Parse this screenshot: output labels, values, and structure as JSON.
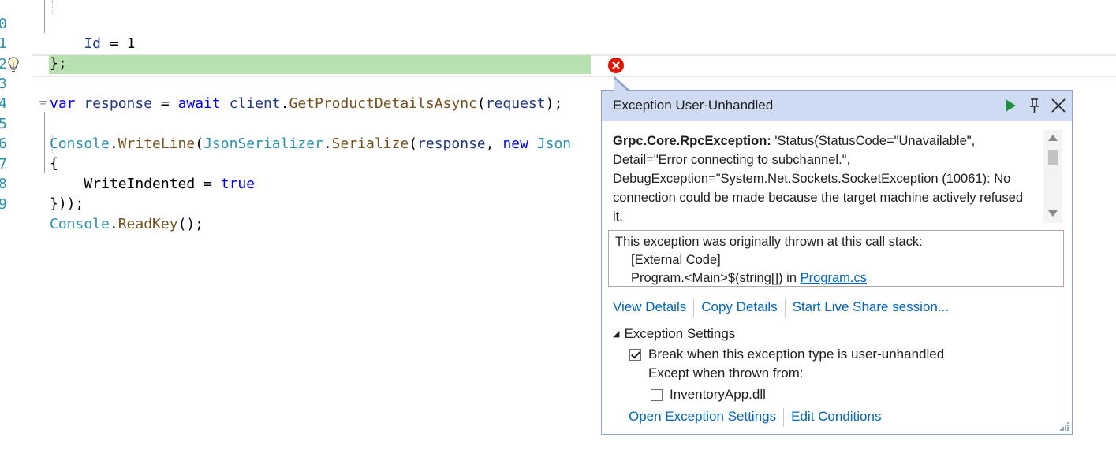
{
  "editor": {
    "lines": [
      {
        "num": "0",
        "code": "    Id = 1"
      },
      {
        "num": "1",
        "code": "};"
      },
      {
        "num": "2",
        "code": ""
      },
      {
        "num": "3",
        "code": "var response = await client.GetProductDetailsAsync(request);"
      },
      {
        "num": "4",
        "code": ""
      },
      {
        "num": "5",
        "code": "Console.WriteLine(JsonSerializer.Serialize(response, new Json"
      },
      {
        "num": "6",
        "code": "{"
      },
      {
        "num": "7",
        "code": "    WriteIndented = true"
      },
      {
        "num": "8",
        "code": "}));"
      },
      {
        "num": "9",
        "code": "Console.ReadKey();"
      }
    ],
    "highlight_color": "#b8e0b0",
    "error_icon": "error-circle-icon",
    "lightbulb_icon": "lightbulb-icon"
  },
  "popup": {
    "title": "Exception User-Unhandled",
    "continue_icon": "play-icon",
    "pin_icon": "pin-icon",
    "close_icon": "close-icon",
    "exception_type": "Grpc.Core.RpcException:",
    "exception_message": " 'Status(StatusCode=\"Unavailable\", Detail=\"Error connecting to subchannel.\", DebugException=\"System.Net.Sockets.SocketException (10061): No connection could be made because the target machine actively refused it.",
    "stack_intro": "This exception was originally thrown at this call stack:",
    "stack_external": "[External Code]",
    "stack_frame": "Program.<Main>$(string[]) in ",
    "stack_file": "Program.cs",
    "links": {
      "view_details": "View Details",
      "copy_details": "Copy Details",
      "live_share": "Start Live Share session..."
    },
    "settings": {
      "header": "Exception Settings",
      "break_label": "Break when this exception type is user-unhandled",
      "break_checked": true,
      "except_label": "Except when thrown from:",
      "module_label": "InventoryApp.dll",
      "module_checked": false
    },
    "bottom_links": {
      "open_settings": "Open Exception Settings",
      "edit_conditions": "Edit Conditions"
    },
    "header_color": "#cfdbf3",
    "link_color": "#0066bf"
  }
}
